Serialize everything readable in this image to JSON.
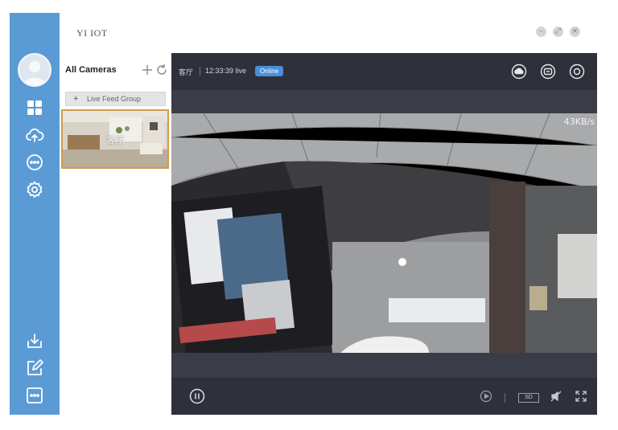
{
  "app": {
    "title": "YI IOT"
  },
  "window_controls": {
    "minimize": "–",
    "restore": "⤢",
    "close": "×"
  },
  "sidebar": {
    "items": [
      {
        "name": "avatar"
      },
      {
        "name": "grid-icon"
      },
      {
        "name": "cloud-upload-icon"
      },
      {
        "name": "chat-icon"
      },
      {
        "name": "settings-icon"
      },
      {
        "name": "download-icon"
      },
      {
        "name": "edit-icon"
      },
      {
        "name": "more-icon"
      }
    ]
  },
  "camera_list": {
    "header": "All Cameras",
    "add_group_label": "Live Feed Group",
    "cameras": [
      {
        "name": "客厅",
        "selected": true
      }
    ]
  },
  "player": {
    "camera_name": "客厅",
    "timestamp": "12:33:39 live",
    "status": "Online",
    "bitrate": "43KB/s",
    "quality": "SD"
  },
  "colors": {
    "sidebar": "#5b9bd5",
    "player_bg": "#3a3d47",
    "toolbar_bg": "#2e313a",
    "accent": "#4a90d9",
    "selected_border": "#d39a4c"
  }
}
